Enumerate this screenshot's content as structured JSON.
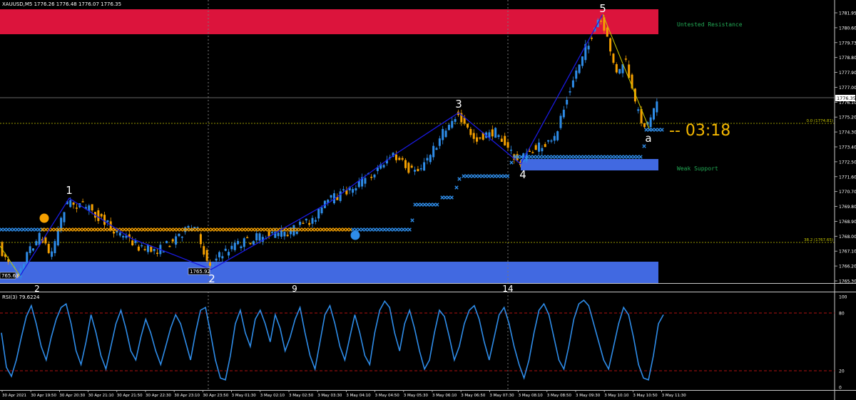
{
  "header": {
    "symbol_info": "XAUUSD,M5  1776.26 1776.48 1776.07 1776.35",
    "rsi_info": "RSI(3) 79.6224"
  },
  "zones": {
    "resistance_label": "Untested Resistance",
    "support_label": "Weak Support"
  },
  "countdown": "-- 03:18",
  "current_price_tag": "1776.35",
  "fib_labels": {
    "level_0": "0.0 (1774.81)",
    "level_382": "38.2 (1767.65)"
  },
  "price_labels": {
    "left_low": "765.63",
    "wave2_low": "1765.92"
  },
  "wave_labels": [
    "1",
    "2",
    "3",
    "4",
    "5",
    "a"
  ],
  "day_markers": [
    "2",
    "9",
    "14"
  ],
  "price_axis": [
    "1781.95",
    "1780.60",
    "1779.73",
    "1778.80",
    "1777.90",
    "1777.00",
    "1776.10",
    "1775.20",
    "1774.30",
    "1773.40",
    "1772.50",
    "1771.60",
    "1770.70",
    "1769.80",
    "1768.90",
    "1768.00",
    "1767.10",
    "1766.20",
    "1765.30"
  ],
  "rsi_axis": [
    "100",
    "80",
    "20",
    "0"
  ],
  "time_axis": [
    "30 Apr 2021",
    "30 Apr 19:50",
    "30 Apr 20:30",
    "30 Apr 21:10",
    "30 Apr 21:50",
    "30 Apr 22:30",
    "30 Apr 23:10",
    "30 Apr 23:50",
    "3 May 01:30",
    "3 May 02:10",
    "3 May 02:50",
    "3 May 03:30",
    "3 May 04:10",
    "3 May 04:50",
    "3 May 05:30",
    "3 May 06:10",
    "3 May 06:50",
    "3 May 07:30",
    "3 May 08:10",
    "3 May 08:50",
    "3 May 09:30",
    "3 May 10:10",
    "3 May 10:50",
    "3 May 11:30"
  ],
  "colors": {
    "bull": "#2e8ce8",
    "bear": "#f5a000",
    "resistance_zone": "#dc143c",
    "support_zone": "#4169e1",
    "wave_line": "#1a1ae0",
    "rsi_line": "#2e8ce8",
    "grid_dots": "#6a6a6a"
  }
}
